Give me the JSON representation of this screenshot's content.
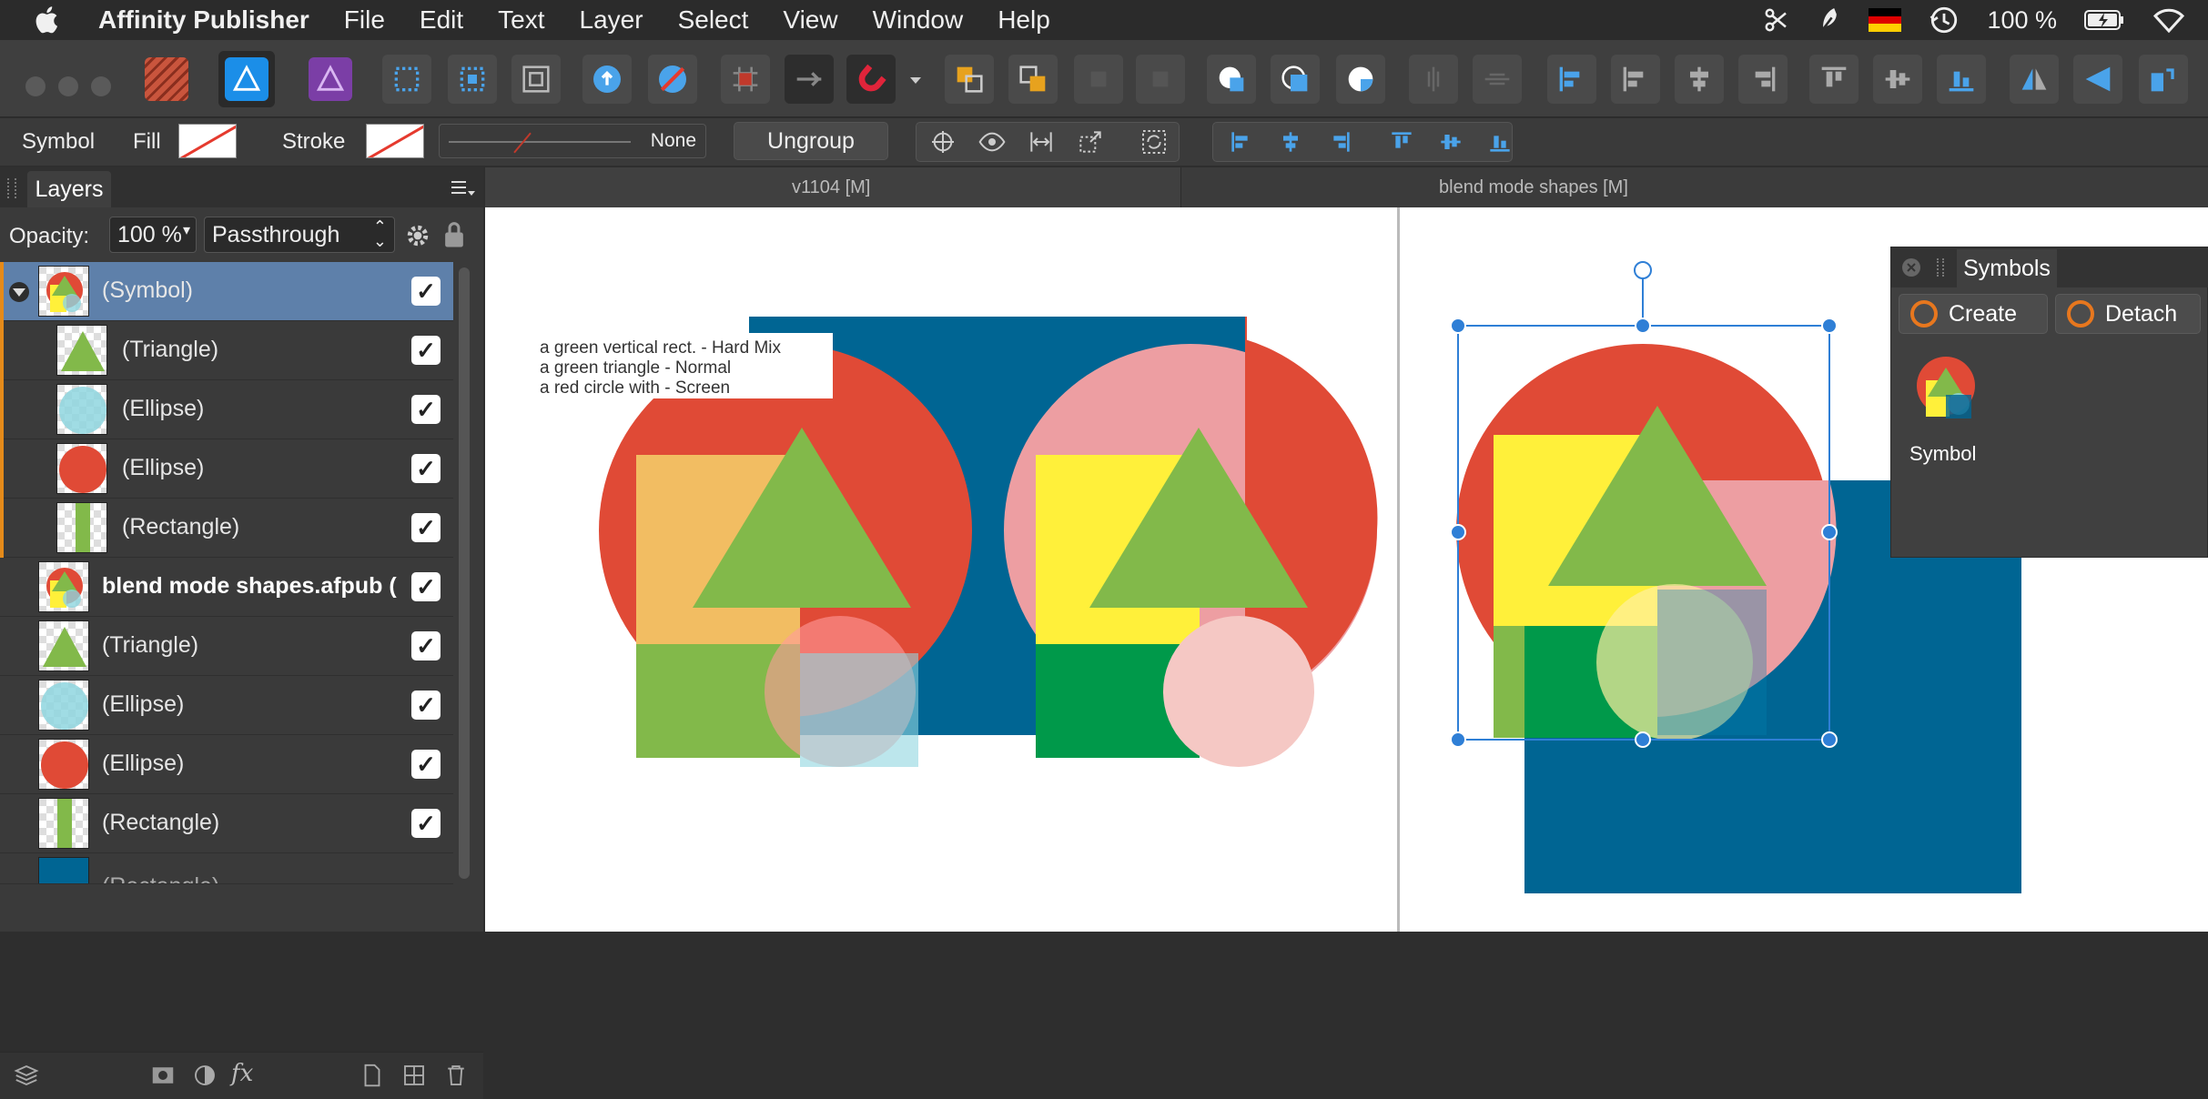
{
  "menubar": {
    "app_name": "Affinity Publisher",
    "items": [
      "File",
      "Edit",
      "Text",
      "Layer",
      "Select",
      "View",
      "Window",
      "Help"
    ],
    "battery": "100 %"
  },
  "toolbar": {
    "personas": [
      "publisher-persona",
      "designer-persona",
      "photo-persona"
    ],
    "tools": [
      "frame-select-icon",
      "move-inside-icon",
      "transform-icon",
      "flower-shape-icon",
      "flower-remove-icon",
      "grid-snap-icon",
      "preflight-icon",
      "magnet-snapping-icon",
      "chevron-down-icon",
      "arrange-back-icon",
      "arrange-front-icon",
      "square-icon",
      "square-icon",
      "add-shape-icon",
      "subtract-shape-icon",
      "intersect-shape-icon",
      "vertical-divide-icon",
      "horizontal-divide-icon",
      "align-left-icon",
      "align-left-2-icon",
      "align-center-icon",
      "align-right-icon",
      "align-top-icon",
      "align-middle-icon",
      "align-bottom-icon",
      "flip-horizontal-icon",
      "flip-vertical-icon",
      "rotate-icon"
    ]
  },
  "context": {
    "type_label": "Symbol",
    "fill_label": "Fill",
    "stroke_label": "Stroke",
    "stroke_value": "None",
    "ungroup_label": "Ungroup"
  },
  "layers": {
    "tab": "Layers",
    "opacity_label": "Opacity:",
    "opacity_value": "100 %",
    "blend_mode": "Passthrough",
    "rows": [
      {
        "label": "(Symbol)",
        "bold": false,
        "indent": false,
        "selected": true,
        "symbol": true
      },
      {
        "label": "(Triangle)",
        "indent": true,
        "symbol": true
      },
      {
        "label": "(Ellipse)",
        "indent": true,
        "symbol": true
      },
      {
        "label": "(Ellipse)",
        "indent": true,
        "symbol": true
      },
      {
        "label": "(Rectangle)",
        "indent": true,
        "symbol": true
      },
      {
        "label": "blend mode shapes.afpub (",
        "bold": true
      },
      {
        "label": "(Triangle)"
      },
      {
        "label": "(Ellipse)"
      },
      {
        "label": "(Ellipse)"
      },
      {
        "label": "(Rectangle)"
      },
      {
        "label": "(Rectangle)"
      }
    ]
  },
  "doc_tabs": [
    "v1104  [M]",
    "blend mode shapes [M]"
  ],
  "canvas": {
    "note_lines": [
      "a green vertical rect. - Hard Mix",
      "a green triangle - Normal",
      "a red circle with - Screen"
    ]
  },
  "symbols_panel": {
    "tab": "Symbols",
    "create_label": "Create",
    "detach_label": "Detach",
    "symbol_name": "Symbol"
  },
  "colors": {
    "accent_blue": "#2f7fd6",
    "red": "#e04a36",
    "green": "#82b94a",
    "blue": "#006593",
    "yellow": "#fff03a",
    "cyan": "#8fd6df"
  }
}
